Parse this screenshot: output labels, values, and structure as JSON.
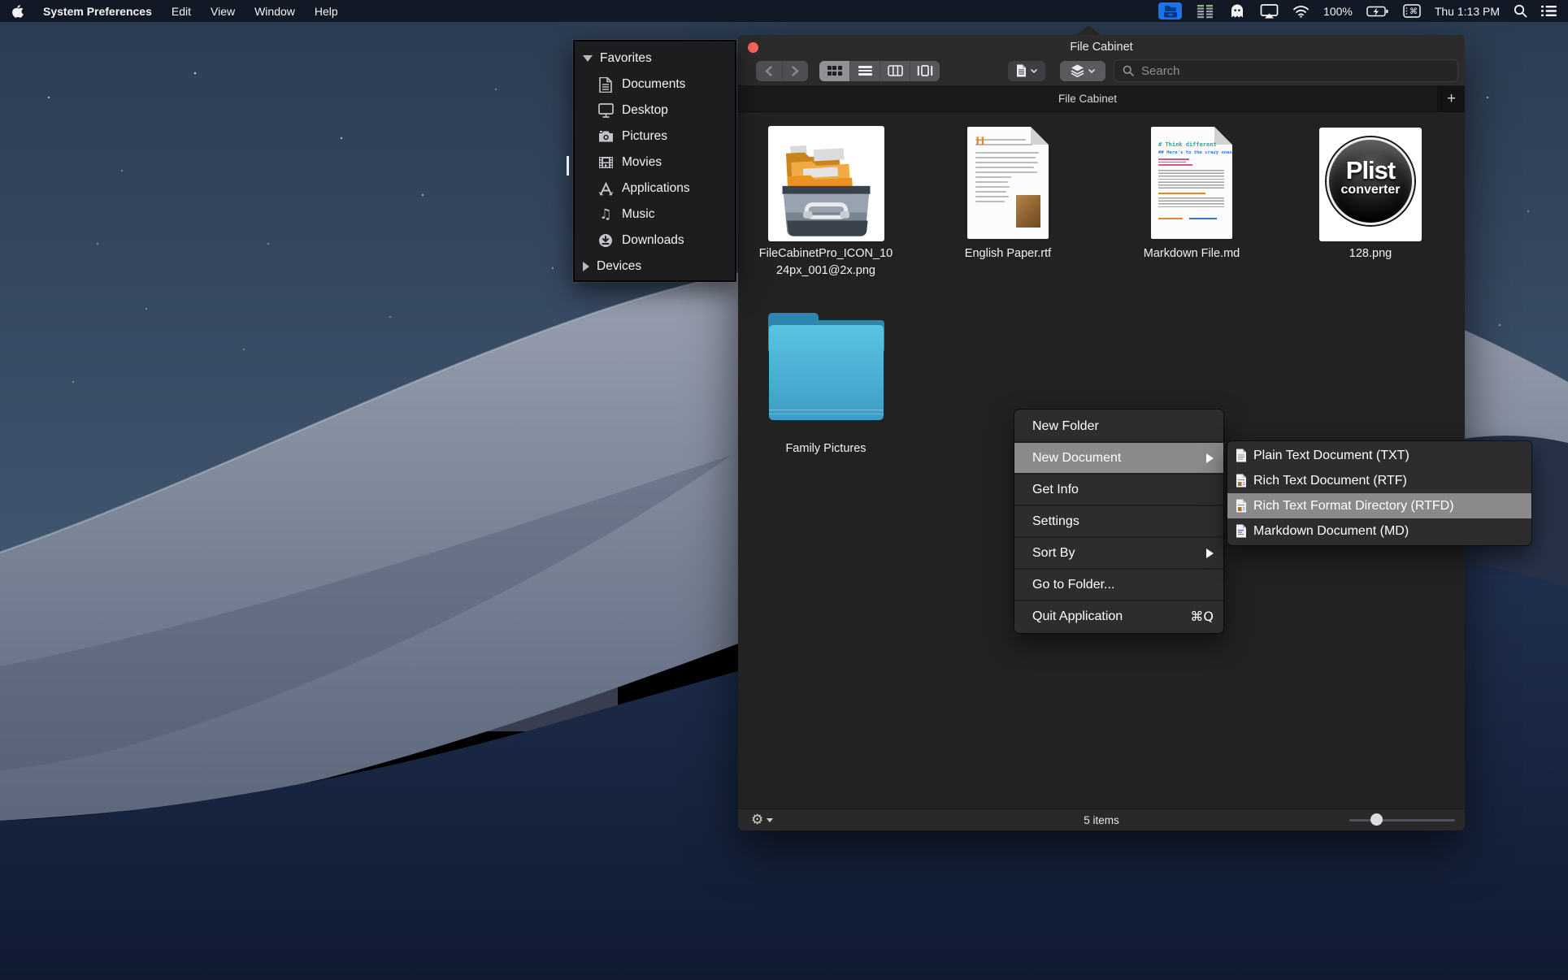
{
  "menu_bar": {
    "app_name": "System Preferences",
    "menus": [
      "Edit",
      "View",
      "Window",
      "Help"
    ],
    "battery_percent": "100%",
    "clock": "Thu 1:13 PM"
  },
  "favorites_panel": {
    "header": "Favorites",
    "items": [
      "Documents",
      "Desktop",
      "Pictures",
      "Movies",
      "Applications",
      "Music",
      "Downloads"
    ],
    "footer": "Devices"
  },
  "window": {
    "title": "File Cabinet",
    "tab_title": "File Cabinet",
    "add_tab_label": "+",
    "search_placeholder": "Search",
    "status_count": "5 items",
    "files": [
      {
        "name_line1": "FileCabinetPro_ICON_10",
        "name_line2": "24px_001@2x.png"
      },
      {
        "name": "English Paper.rtf"
      },
      {
        "name": "Markdown File.md"
      },
      {
        "name": "128.png"
      },
      {
        "name": "Family Pictures"
      }
    ],
    "previews": {
      "english_dropcap": "H",
      "md_h1": "# Think different",
      "md_h2": "## Here's to the crazy ones.",
      "plist_line1": "Plist",
      "plist_line2": "converter"
    }
  },
  "context_menu": {
    "items": [
      {
        "label": "New Folder"
      },
      {
        "label": "New Document"
      },
      {
        "label": "Get Info"
      },
      {
        "label": "Settings"
      },
      {
        "label": "Sort By"
      },
      {
        "label": "Go to Folder..."
      },
      {
        "label": "Quit Application",
        "shortcut": "⌘Q"
      }
    ]
  },
  "submenu": {
    "items": [
      {
        "label": "Plain Text Document (TXT)"
      },
      {
        "label": "Rich Text Document (RTF)"
      },
      {
        "label": "Rich Text Format Directory (RTFD)"
      },
      {
        "label": "Markdown Document (MD)"
      }
    ]
  },
  "icons": {
    "gear": "⚙",
    "music_note": "♫",
    "command": "⌘"
  },
  "colors": {
    "menubar_highlight_blue": "#1a74ee",
    "close_red": "#f9655f",
    "menu_highlight_gray": "#8a8a8c",
    "folder_blue": "#46aed4"
  }
}
